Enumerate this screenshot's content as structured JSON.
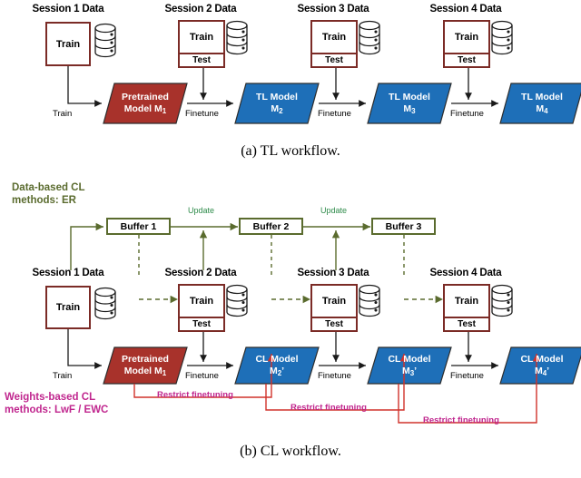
{
  "colors": {
    "data_box_border": "#7B2B26",
    "pretrained_fill": "#A8322B",
    "model_fill": "#1E6FB8",
    "buffer_border": "#5A6B2E",
    "buffer_arrow": "#5A6B2E",
    "update_text": "#2E8B4A",
    "restrict_line": "#D1322B",
    "restrict_text": "#C0268E",
    "weights_label": "#C0268E",
    "data_label": "#5A6B2E",
    "arrow_black": "#1A1A1A"
  },
  "panel_a": {
    "caption": "(a) TL workflow.",
    "sessions": [
      {
        "title": "Session 1 Data",
        "train": "Train",
        "test": null
      },
      {
        "title": "Session 2 Data",
        "train": "Train",
        "test": "Test"
      },
      {
        "title": "Session 3 Data",
        "train": "Train",
        "test": "Test"
      },
      {
        "title": "Session 4 Data",
        "train": "Train",
        "test": "Test"
      }
    ],
    "edge_labels": [
      "Train",
      "Finetune",
      "Finetune",
      "Finetune"
    ],
    "models": [
      {
        "line1": "Pretrained",
        "line2": "Model M",
        "sub": "1",
        "kind": "pretrained"
      },
      {
        "line1": "TL Model",
        "line2": "M",
        "sub": "2",
        "kind": "tl"
      },
      {
        "line1": "TL Model",
        "line2": "M",
        "sub": "3",
        "kind": "tl"
      },
      {
        "line1": "TL Model",
        "line2": "M",
        "sub": "4",
        "kind": "tl"
      }
    ]
  },
  "panel_b": {
    "caption": "(b) CL workflow.",
    "data_cl_label_line1": "Data-based CL",
    "data_cl_label_line2": "methods: ER",
    "weights_cl_label_line1": "Weights-based CL",
    "weights_cl_label_line2": "methods: LwF / EWC",
    "buffers": [
      "Buffer 1",
      "Buffer 2",
      "Buffer 3"
    ],
    "update_labels": [
      "Update",
      "Update"
    ],
    "sessions": [
      {
        "title": "Session 1 Data",
        "train": "Train",
        "test": null
      },
      {
        "title": "Session 2 Data",
        "train": "Train",
        "test": "Test"
      },
      {
        "title": "Session 3 Data",
        "train": "Train",
        "test": "Test"
      },
      {
        "title": "Session 4 Data",
        "train": "Train",
        "test": "Test"
      }
    ],
    "edge_labels": [
      "Train",
      "Finetune",
      "Finetune",
      "Finetune"
    ],
    "models": [
      {
        "line1": "Pretrained",
        "line2": "Model M",
        "sub": "1",
        "prime": "",
        "kind": "pretrained"
      },
      {
        "line1": "CL Model",
        "line2": "M",
        "sub": "2",
        "prime": "’",
        "kind": "cl"
      },
      {
        "line1": "CL Model",
        "line2": "M",
        "sub": "3",
        "prime": "’",
        "kind": "cl"
      },
      {
        "line1": "CL Model",
        "line2": "M",
        "sub": "4",
        "prime": "’",
        "kind": "cl"
      }
    ],
    "restrict_labels": [
      "Restrict finetuning",
      "Restrict finetuning",
      "Restrict finetuning"
    ]
  }
}
